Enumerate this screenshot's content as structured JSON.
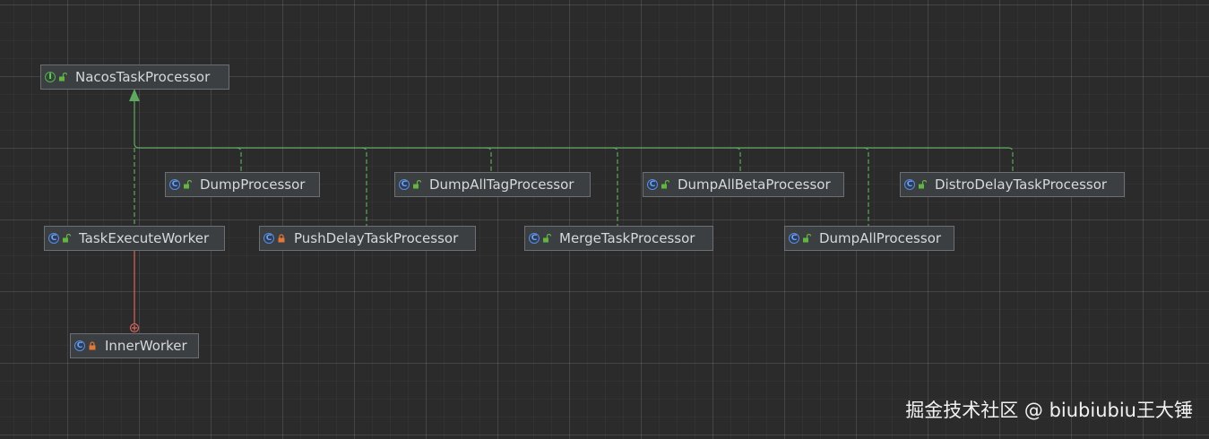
{
  "diagram": {
    "nodes": [
      {
        "id": "nacos",
        "label": "NacosTaskProcessor",
        "kind": "interface",
        "kind_icon": "interface-icon",
        "visibility": "public"
      },
      {
        "id": "dump",
        "label": "DumpProcessor",
        "kind": "class",
        "kind_icon": "class-icon",
        "visibility": "public"
      },
      {
        "id": "dumpalltag",
        "label": "DumpAllTagProcessor",
        "kind": "class",
        "kind_icon": "class-icon",
        "visibility": "public"
      },
      {
        "id": "dumpallbeta",
        "label": "DumpAllBetaProcessor",
        "kind": "class",
        "kind_icon": "class-icon",
        "visibility": "public"
      },
      {
        "id": "distro",
        "label": "DistroDelayTaskProcessor",
        "kind": "class",
        "kind_icon": "class-icon",
        "visibility": "public"
      },
      {
        "id": "taskexec",
        "label": "TaskExecuteWorker",
        "kind": "class",
        "kind_icon": "class-icon",
        "visibility": "public"
      },
      {
        "id": "pushdelay",
        "label": "PushDelayTaskProcessor",
        "kind": "class",
        "kind_icon": "class-icon",
        "visibility": "private"
      },
      {
        "id": "merge",
        "label": "MergeTaskProcessor",
        "kind": "class",
        "kind_icon": "class-icon",
        "visibility": "public"
      },
      {
        "id": "dumpall",
        "label": "DumpAllProcessor",
        "kind": "class",
        "kind_icon": "class-icon",
        "visibility": "public"
      },
      {
        "id": "inner",
        "label": "InnerWorker",
        "kind": "class",
        "kind_icon": "class-icon",
        "visibility": "private"
      }
    ],
    "edges": [
      {
        "from": "dump",
        "to": "nacos",
        "type": "implements"
      },
      {
        "from": "dumpalltag",
        "to": "nacos",
        "type": "implements"
      },
      {
        "from": "dumpallbeta",
        "to": "nacos",
        "type": "implements"
      },
      {
        "from": "distro",
        "to": "nacos",
        "type": "implements"
      },
      {
        "from": "taskexec",
        "to": "nacos",
        "type": "implements"
      },
      {
        "from": "pushdelay",
        "to": "nacos",
        "type": "implements"
      },
      {
        "from": "merge",
        "to": "nacos",
        "type": "implements"
      },
      {
        "from": "dumpall",
        "to": "nacos",
        "type": "implements"
      },
      {
        "from": "inner",
        "to": "taskexec",
        "type": "inner-class"
      }
    ]
  },
  "colors": {
    "implements": "#5fa85f",
    "inner_class": "#d9665f",
    "class_badge": "#5b8de0",
    "interface_badge": "#5cab5c",
    "public_lock": "#62b543",
    "private_lock": "#e0773c"
  },
  "watermark": "掘金技术社区 @ biubiubiu王大锤"
}
